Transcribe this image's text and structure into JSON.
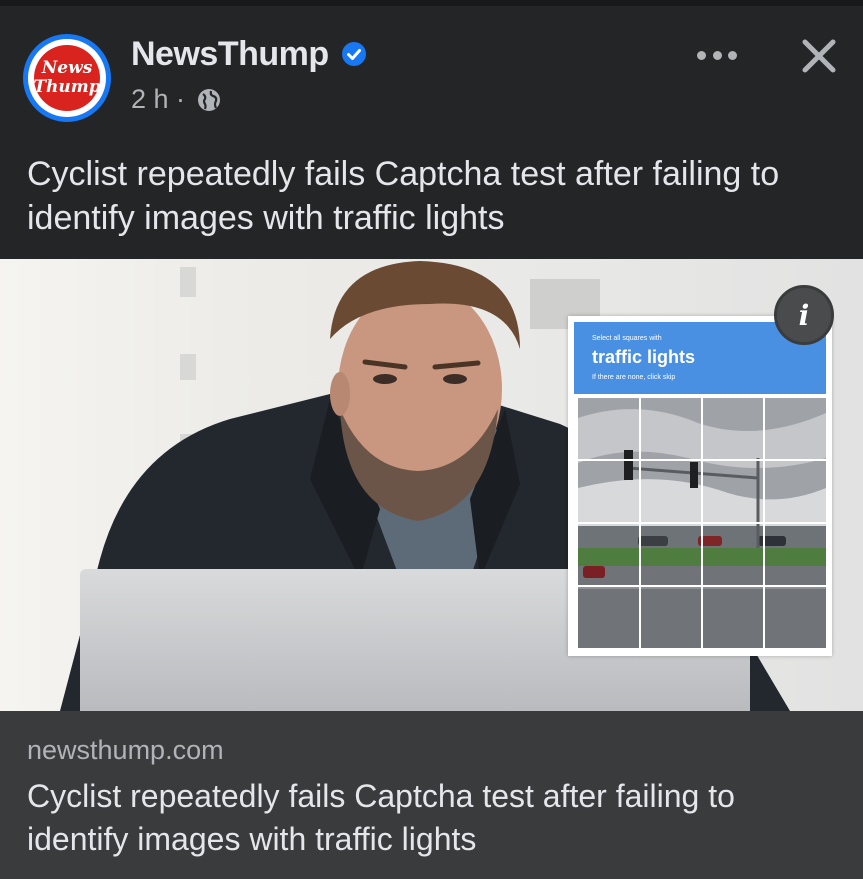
{
  "post": {
    "page_name": "NewsThump",
    "avatar_text_line1": "News",
    "avatar_text_line2": "Thump",
    "timestamp": "2 h ·",
    "text": "Cyclist repeatedly fails Captcha test after failing to identify images with traffic lights",
    "icons": [
      "verified-badge-icon",
      "globe-icon",
      "more-icon",
      "close-icon",
      "info-icon"
    ]
  },
  "image": {
    "captcha": {
      "instruction": "Select all squares with",
      "target": "traffic lights",
      "hint": "If there are none, click skip"
    },
    "info_label": "i"
  },
  "link": {
    "domain": "newsthump.com",
    "title": "Cyclist repeatedly fails Captcha test after failing to identify images with traffic lights"
  },
  "colors": {
    "background": "#242526",
    "link_preview_bg": "#3a3b3c",
    "verified_blue": "#1877f2",
    "captcha_blue": "#4a90e2",
    "logo_red": "#d8231f"
  }
}
